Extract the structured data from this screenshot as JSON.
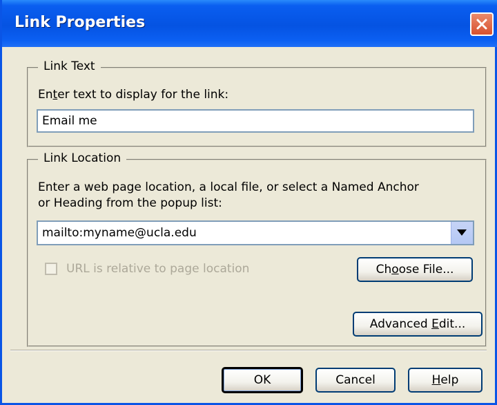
{
  "window": {
    "title": "Link Properties",
    "close_icon": "close-icon"
  },
  "link_text": {
    "group_label": "Link Text",
    "prompt_before": "En",
    "prompt_accel": "t",
    "prompt_after": "er text to display for the link:",
    "value": "Email me"
  },
  "link_location": {
    "group_label": "Link Location",
    "prompt_line1": "Enter a web page location, a local file, or select a Named Anchor",
    "prompt_line2": "or Heading from the popup list:",
    "value": "mailto:myname@ucla.edu",
    "dropdown_icon": "chevron-down-icon",
    "relative_checkbox_label": "URL is relative to page location",
    "relative_checked": false,
    "choose_file_before": "Ch",
    "choose_file_accel": "o",
    "choose_file_after": "ose File..."
  },
  "buttons": {
    "advanced_before": "Advanced ",
    "advanced_accel": "E",
    "advanced_after": "dit...",
    "ok": "OK",
    "cancel": "Cancel",
    "help_accel": "H",
    "help_after": "elp"
  },
  "colors": {
    "titlebar": "#0553e2",
    "dialog_bg": "#ece9d8",
    "close_button": "#d8512e"
  }
}
